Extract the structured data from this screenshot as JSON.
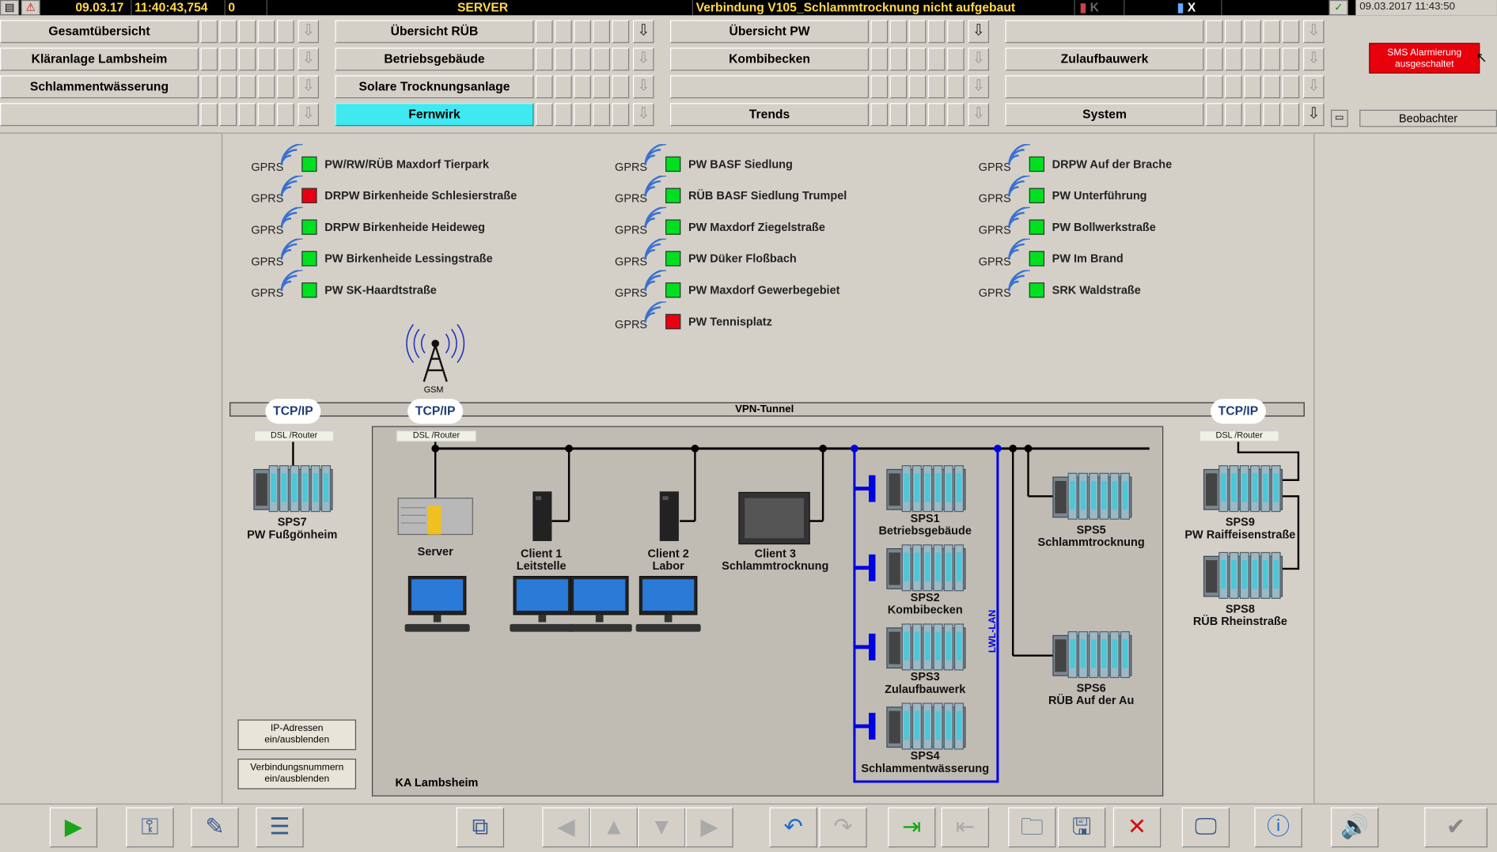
{
  "topbar": {
    "date": "09.03.17",
    "time": "11:40:43,754",
    "counter": "0",
    "host": "SERVER",
    "message": "Verbindung V105_Schlammtrocknung nicht aufgebaut",
    "k_label": "K",
    "x_label": "X",
    "clock": "09.03.2017 11:43:50"
  },
  "nav": {
    "col1": [
      "Gesamtübersicht",
      "Kläranlage Lambsheim",
      "Schlammentwässerung",
      ""
    ],
    "col2": [
      "Übersicht RÜB",
      "Betriebsgebäude",
      "Solare Trocknungsanlage",
      "Fernwirk"
    ],
    "col3": [
      "Übersicht PW",
      "Kombibecken",
      "",
      "Trends"
    ],
    "col4": [
      "",
      "Zulaufbauwerk",
      "",
      "System"
    ],
    "active": "Fernwirk"
  },
  "sms": {
    "line1": "SMS Alarmierung",
    "line2": "ausgeschaltet"
  },
  "user": "Beobachter",
  "gprs_label": "GPRS",
  "stations": {
    "col1": [
      {
        "name": "PW/RW/RÜB Maxdorf Tierpark",
        "status": "ok"
      },
      {
        "name": "DRPW Birkenheide Schlesierstraße",
        "status": "err"
      },
      {
        "name": "DRPW Birkenheide Heideweg",
        "status": "ok"
      },
      {
        "name": "PW Birkenheide Lessingstraße",
        "status": "ok"
      },
      {
        "name": "PW SK-Haardtstraße",
        "status": "ok"
      }
    ],
    "col2": [
      {
        "name": "PW BASF Siedlung",
        "status": "ok"
      },
      {
        "name": "RÜB BASF Siedlung Trumpel",
        "status": "ok"
      },
      {
        "name": "PW Maxdorf Ziegelstraße",
        "status": "ok"
      },
      {
        "name": "PW Düker Floßbach",
        "status": "ok"
      },
      {
        "name": "PW Maxdorf Gewerbegebiet",
        "status": "ok"
      },
      {
        "name": "PW Tennisplatz",
        "status": "err"
      }
    ],
    "col3": [
      {
        "name": "DRPW Auf der Brache",
        "status": "ok"
      },
      {
        "name": "PW Unterführung",
        "status": "ok"
      },
      {
        "name": "PW Bollwerkstraße",
        "status": "ok"
      },
      {
        "name": "PW Im Brand",
        "status": "ok"
      },
      {
        "name": "SRK Waldstraße",
        "status": "ok"
      }
    ]
  },
  "network": {
    "gsm": "GSM",
    "vpn": "VPN-Tunnel",
    "tcp": "TCP/IP",
    "dsl": "DSL /Router",
    "lwl": "LWL-LAN",
    "site": "KA Lambsheim"
  },
  "devices": {
    "sps7": [
      "SPS7",
      "PW Fußgönheim"
    ],
    "server": "Server",
    "client1": [
      "Client 1",
      "Leitstelle"
    ],
    "client2": [
      "Client 2",
      "Labor"
    ],
    "client3": [
      "Client 3",
      "Schlammtrocknung"
    ],
    "sps1": [
      "SPS1",
      "Betriebsgebäude"
    ],
    "sps2": [
      "SPS2",
      "Kombibecken"
    ],
    "sps3": [
      "SPS3",
      "Zulaufbauwerk"
    ],
    "sps4": [
      "SPS4",
      "Schlammentwässerung"
    ],
    "sps5": [
      "SPS5",
      "Schlammtrocknung"
    ],
    "sps6": [
      "SPS6",
      "RÜB Auf der Au"
    ],
    "sps9": [
      "SPS9",
      "PW Raiffeisenstraße"
    ],
    "sps8": [
      "SPS8",
      "RÜB Rheinstraße"
    ]
  },
  "buttons": {
    "ip": [
      "IP-Adressen",
      "ein/ausblenden"
    ],
    "conn": [
      "Verbindungsnummern",
      "ein/ausblenden"
    ]
  },
  "toolbar": [
    "play-icon",
    "key-icon",
    "notepad-icon",
    "list-settings-icon",
    "window-switch-icon",
    "arrow-left-icon",
    "arrow-up-icon",
    "arrow-down-icon",
    "arrow-right-icon",
    "undo-icon",
    "redo-icon",
    "import-icon",
    "export-icon",
    "folders-icon",
    "save-icon",
    "delete-icon",
    "monitor-icon",
    "info-icon",
    "audio-ack-icon",
    "acknowledge-all-icon"
  ],
  "colors": {
    "ok": "#00e020",
    "err": "#e80010",
    "active": "#40e8f0",
    "lwl": "#0000e0",
    "alarm_text": "#ffd84a"
  }
}
